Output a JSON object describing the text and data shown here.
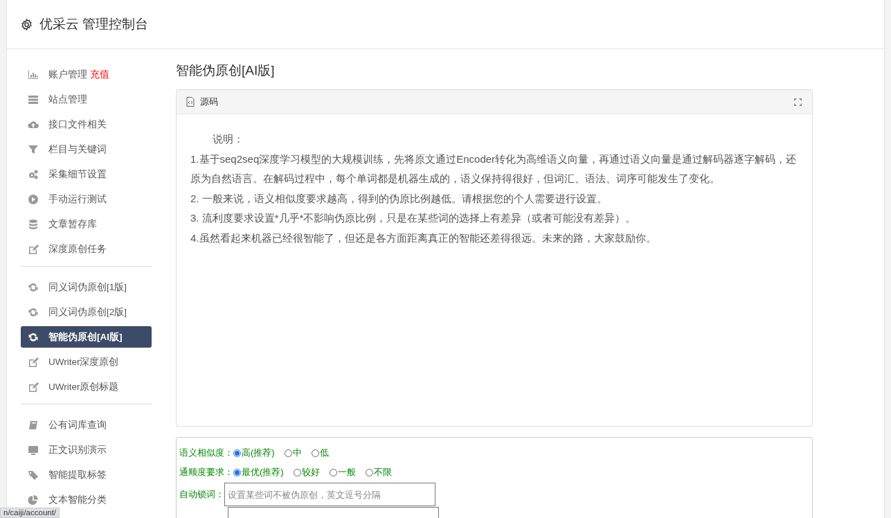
{
  "header": {
    "title": "优采云 管理控制台"
  },
  "sidebar": {
    "groups": [
      {
        "items": [
          {
            "label": "账户管理",
            "badge": "充值",
            "selected": false
          },
          {
            "label": "站点管理",
            "selected": false
          },
          {
            "label": "接口文件相关",
            "selected": false
          },
          {
            "label": "栏目与关键词",
            "selected": false
          },
          {
            "label": "采集细节设置",
            "selected": false
          },
          {
            "label": "手动运行测试",
            "selected": false
          },
          {
            "label": "文章暂存库",
            "selected": false
          },
          {
            "label": "深度原创任务",
            "selected": false
          }
        ]
      },
      {
        "items": [
          {
            "label": "同义词伪原创[1版]",
            "selected": false
          },
          {
            "label": "同义词伪原创[2版]",
            "selected": false
          },
          {
            "label": "智能伪原创[AI版]",
            "selected": true
          },
          {
            "label": "UWriter深度原创",
            "selected": false
          },
          {
            "label": "UWriter原创标题",
            "selected": false
          }
        ]
      },
      {
        "items": [
          {
            "label": "公有词库查询",
            "selected": false
          },
          {
            "label": "正文识别演示",
            "selected": false
          },
          {
            "label": "智能提取标签",
            "selected": false
          },
          {
            "label": "文本智能分类",
            "selected": false
          }
        ]
      }
    ]
  },
  "page_title": "智能伪原创[AI版]",
  "editor": {
    "tab": "源码",
    "heading": "说明：",
    "paragraphs": [
      "1.基于seq2seq深度学习模型的大规模训练，先将原文通过Encoder转化为高维语义向量，再通过语义向量是通过解码器逐字解码，还原为自然语言。在解码过程中，每个单词都是机器生成的，语义保持得很好，但词汇、语法、词序可能发生了变化。",
      "2. 一般来说，语义相似度要求越高，得到的伪原比例越低。请根据您的个人需要进行设置。",
      "3. 流利度要求设置*几乎*不影响伪原比例，只是在某些词的选择上有差异（或者可能没有差异）。",
      "4.虽然看起来机器已经很智能了，但还是各方面距离真正的智能还差得很远。未来的路，大家鼓励你。"
    ]
  },
  "form": {
    "radio_groups": [
      {
        "label": "语义相似度：",
        "options": [
          {
            "label": "高(推荐)",
            "selected": true
          },
          {
            "label": "中",
            "selected": false
          },
          {
            "label": "低",
            "selected": false
          }
        ]
      },
      {
        "label": "通顺度要求：",
        "options": [
          {
            "label": "最优(推荐)",
            "selected": true
          },
          {
            "label": "较好",
            "selected": false
          },
          {
            "label": "一般",
            "selected": false
          },
          {
            "label": "不限",
            "selected": false
          }
        ]
      }
    ],
    "lock_words": {
      "label": "自动锁词：",
      "placeholder": "设置某些词不被伪原创，英文逗号分隔"
    }
  },
  "status_url": "n/caiji/account/"
}
